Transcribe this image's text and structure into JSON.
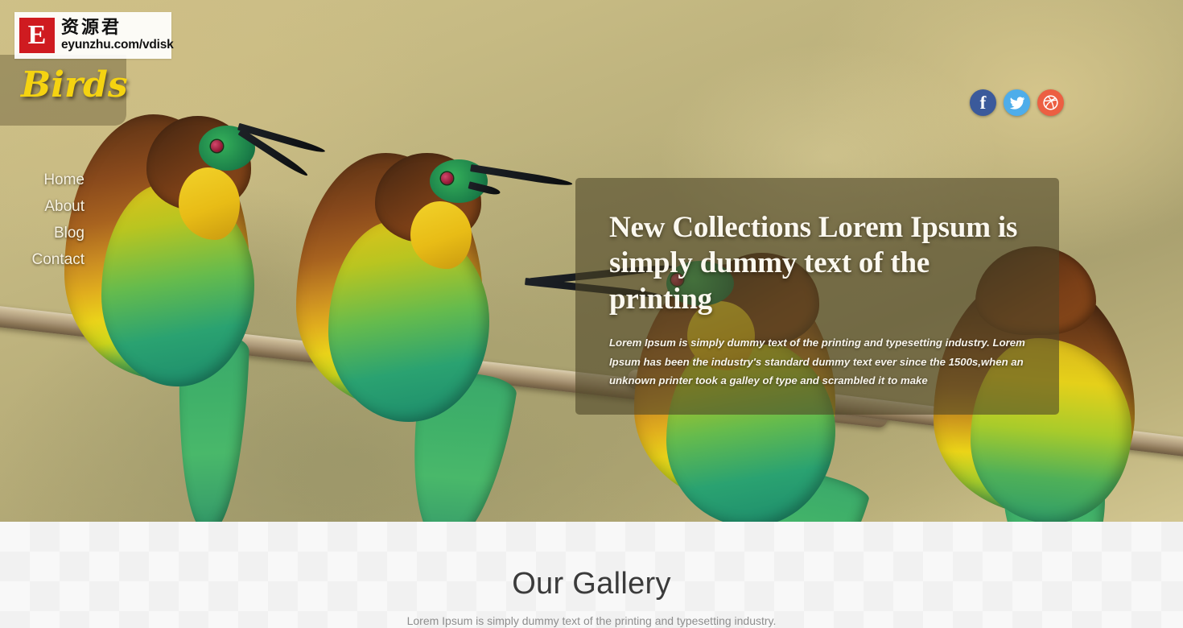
{
  "watermark": {
    "badge_letter": "E",
    "chinese": "资源君",
    "url": "eyunzhu.com/vdisk"
  },
  "brand": {
    "logo_text": "Birds"
  },
  "nav": {
    "items": [
      {
        "label": "Home"
      },
      {
        "label": "About"
      },
      {
        "label": "Blog"
      },
      {
        "label": "Contact"
      }
    ]
  },
  "social": {
    "items": [
      {
        "name": "facebook",
        "glyph": "f",
        "color": "#3b5a9b"
      },
      {
        "name": "twitter",
        "glyph": "",
        "color": "#4eadea"
      },
      {
        "name": "dribbble",
        "glyph": "",
        "color": "#ec5f42"
      }
    ]
  },
  "hero": {
    "title": "New Collections Lorem Ipsum is simply dummy text of the printing",
    "description": "Lorem Ipsum is simply dummy text of the printing and typesetting industry. Lorem Ipsum has been the industry's standard dummy text ever since the 1500s,when an unknown printer took a galley of type and scrambled it to make"
  },
  "gallery": {
    "title": "Our Gallery",
    "subtitle": "Lorem Ipsum is simply dummy text of the printing and typesetting industry."
  },
  "colors": {
    "accent_yellow": "#f5d311",
    "watermark_red": "#cf1b20",
    "hero_card_overlay": "rgba(78,70,40,0.60)",
    "gallery_bg": "#f8f8f8"
  }
}
